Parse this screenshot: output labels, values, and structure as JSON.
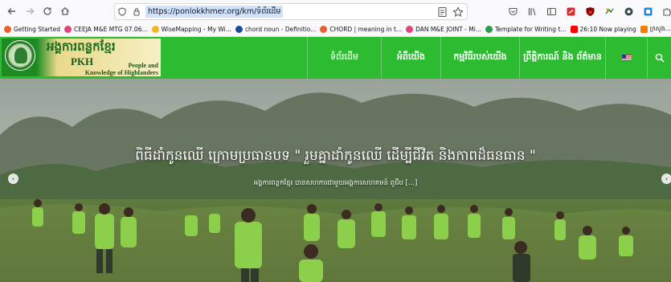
{
  "browser": {
    "url": "https://ponlokkhmer.org/km/ទំព័រដើម",
    "icons": [
      "back-arrow-icon",
      "forward-arrow-icon",
      "reload-icon",
      "home-icon",
      "shield-icon",
      "lock-icon",
      "reader-view-icon",
      "bookmark-star-icon",
      "pocket-icon",
      "library-icon",
      "sidebar-icon",
      "extension-icon",
      "ublock-icon",
      "extension-icon",
      "extension-icon",
      "extension-icon",
      "extensions-puzzle-icon"
    ]
  },
  "bookmarks": [
    {
      "label": "Getting Started",
      "color": "#e8612c"
    },
    {
      "label": "CEEJA M&E MTG 07.06...",
      "color": "#e0457b"
    },
    {
      "label": "WiseMapping - My Wi...",
      "color": "#f3b51b"
    },
    {
      "label": "chord noun - Definitio...",
      "color": "#1a4c9c"
    },
    {
      "label": "CHORD | meaning in t...",
      "color": "#e8612c"
    },
    {
      "label": "DAN M&E JOINT - Mi...",
      "color": "#e0457b"
    },
    {
      "label": "Template for Writing t...",
      "color": "#2c9c4a"
    },
    {
      "label": "26:10  Now playing",
      "color": "#ff0000"
    },
    {
      "label": "ក្រសួង...",
      "color": "#f57c00"
    }
  ],
  "site": {
    "logo": {
      "org_khmer": "អង្គការពន្លកខ្មែរ",
      "abbr": "PKH",
      "tagline_line1": "People and",
      "tagline_line2": "Knowledge of Highlanders"
    },
    "menu": [
      {
        "label": "ទំព័រដើម",
        "active": true
      },
      {
        "label": "អំពីយើង",
        "active": false
      },
      {
        "label": "កម្មវិធីរបស់យើង",
        "active": false
      },
      {
        "label": "ព្រឹត្តិការណ៍ និង ព័ត៌មាន",
        "active": false
      }
    ],
    "language_flag": "us-flag-icon",
    "search_icon": "search-icon",
    "accent_color": "#2dbb32"
  },
  "hero": {
    "title": "ពិធីដាំកូនឈើ ក្រោមប្រធានបទ \" រួមគ្នាដាំកូនឈើ ដើម្បីជីវិត និងកាពដ៏ធនធាន \"",
    "subtitle": "អង្គការពន្លកខ្មែរ បានសហការជាមួយអង្គការសហគមន៍ ពូជីប [...]",
    "prev_label": "‹",
    "next_label": "›"
  }
}
